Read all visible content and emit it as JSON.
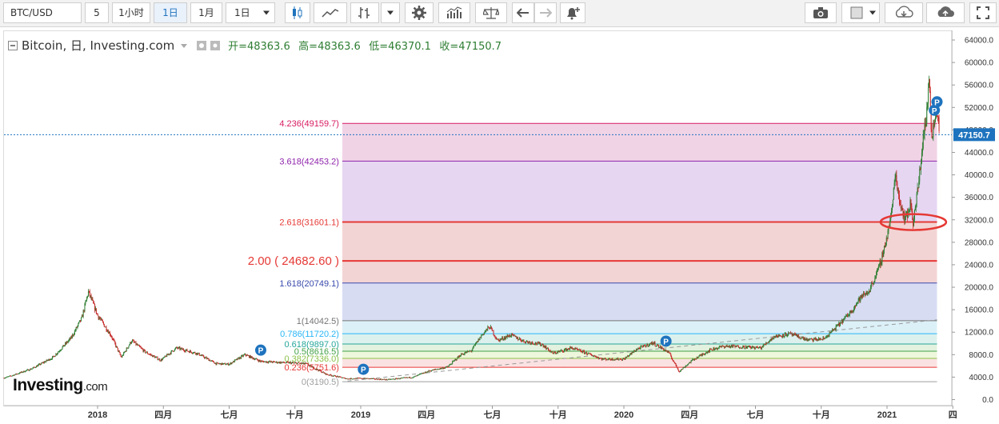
{
  "toolbar": {
    "symbol": "BTC/USD",
    "interval_value": "5",
    "btn_1h": "1小时",
    "btn_1d": "1日",
    "btn_1mo": "1月",
    "btn_1d_b": "1日"
  },
  "header": {
    "title": "Bitcoin, 日, Investing.com",
    "open": "开=48363.6",
    "high": "高=48363.6",
    "low": "低=46370.1",
    "close": "收=47150.7"
  },
  "logo": {
    "brand": "Investing",
    "suffix": ".com"
  },
  "current_price_label": "47150.7",
  "colors": {
    "accent": "#1e73be",
    "price_tag": "#1e73be",
    "candle_up": "#2e7d32",
    "candle_down": "#c62828",
    "annotation_red": "#e53935"
  },
  "chart_data": {
    "type": "candlestick",
    "title": "Bitcoin, 日, Investing.com",
    "ylim": [
      -500,
      65000
    ],
    "y_ticks": [
      0,
      4000,
      8000,
      12000,
      16000,
      20000,
      24000,
      28000,
      32000,
      36000,
      40000,
      44000,
      48000,
      52000,
      56000,
      60000,
      64000
    ],
    "y_tick_labels": [
      "0.0",
      "4000.0",
      "8000.0",
      "12000.0",
      "16000.0",
      "20000.0",
      "24000.0",
      "28000.0",
      "32000.0",
      "36000.0",
      "40000.0",
      "44000.0",
      "48000.0",
      "52000.0",
      "56000.0",
      "60000.0",
      "64000.0"
    ],
    "x_ticks": [
      {
        "label": "2018",
        "t": 2018.0
      },
      {
        "label": "四月",
        "t": 2018.25
      },
      {
        "label": "七月",
        "t": 2018.5
      },
      {
        "label": "十月",
        "t": 2018.75
      },
      {
        "label": "2019",
        "t": 2019.0
      },
      {
        "label": "四月",
        "t": 2019.25
      },
      {
        "label": "七月",
        "t": 2019.5
      },
      {
        "label": "十月",
        "t": 2019.75
      },
      {
        "label": "2020",
        "t": 2020.0
      },
      {
        "label": "四月",
        "t": 2020.25
      },
      {
        "label": "七月",
        "t": 2020.5
      },
      {
        "label": "十月",
        "t": 2020.75
      },
      {
        "label": "2021",
        "t": 2021.0
      },
      {
        "label": "四",
        "t": 2021.25
      }
    ],
    "price_path": [
      [
        2017.58,
        3000
      ],
      [
        2017.67,
        4200
      ],
      [
        2017.75,
        5500
      ],
      [
        2017.83,
        7500
      ],
      [
        2017.9,
        11000
      ],
      [
        2017.94,
        14500
      ],
      [
        2017.965,
        19200
      ],
      [
        2018.0,
        15000
      ],
      [
        2018.05,
        11500
      ],
      [
        2018.09,
        7500
      ],
      [
        2018.13,
        10500
      ],
      [
        2018.18,
        8500
      ],
      [
        2018.24,
        7000
      ],
      [
        2018.3,
        9200
      ],
      [
        2018.38,
        8200
      ],
      [
        2018.45,
        6400
      ],
      [
        2018.5,
        6300
      ],
      [
        2018.56,
        8000
      ],
      [
        2018.62,
        6800
      ],
      [
        2018.7,
        6600
      ],
      [
        2018.79,
        6400
      ],
      [
        2018.87,
        4500
      ],
      [
        2018.95,
        3700
      ],
      [
        2019.0,
        3800
      ],
      [
        2019.1,
        3550
      ],
      [
        2019.2,
        4000
      ],
      [
        2019.26,
        5100
      ],
      [
        2019.33,
        5800
      ],
      [
        2019.38,
        8000
      ],
      [
        2019.42,
        8700
      ],
      [
        2019.46,
        11500
      ],
      [
        2019.49,
        13000
      ],
      [
        2019.52,
        10500
      ],
      [
        2019.57,
        11500
      ],
      [
        2019.62,
        10400
      ],
      [
        2019.69,
        9800
      ],
      [
        2019.73,
        8200
      ],
      [
        2019.8,
        9200
      ],
      [
        2019.85,
        8400
      ],
      [
        2019.92,
        7200
      ],
      [
        2020.0,
        7200
      ],
      [
        2020.05,
        9000
      ],
      [
        2020.11,
        10100
      ],
      [
        2020.17,
        8400
      ],
      [
        2020.21,
        5000
      ],
      [
        2020.26,
        7000
      ],
      [
        2020.33,
        8900
      ],
      [
        2020.38,
        9500
      ],
      [
        2020.45,
        9400
      ],
      [
        2020.52,
        9200
      ],
      [
        2020.57,
        11200
      ],
      [
        2020.63,
        11700
      ],
      [
        2020.7,
        10600
      ],
      [
        2020.76,
        10800
      ],
      [
        2020.81,
        13000
      ],
      [
        2020.86,
        15500
      ],
      [
        2020.9,
        18200
      ],
      [
        2020.93,
        19200
      ],
      [
        2020.97,
        23500
      ],
      [
        2021.0,
        29000
      ],
      [
        2021.02,
        34000
      ],
      [
        2021.03,
        40500
      ],
      [
        2021.05,
        35000
      ],
      [
        2021.07,
        32000
      ],
      [
        2021.09,
        35000
      ],
      [
        2021.1,
        31500
      ],
      [
        2021.12,
        38500
      ],
      [
        2021.14,
        48000
      ],
      [
        2021.15,
        50000
      ],
      [
        2021.16,
        57500
      ],
      [
        2021.17,
        47000
      ],
      [
        2021.19,
        52000
      ],
      [
        2021.2,
        47150.7
      ]
    ],
    "fib_levels": [
      {
        "label": "0(3190.5)",
        "value": 3190.5,
        "color": "#9e9e9e",
        "fill": "#ffffff"
      },
      {
        "label": "0.236(5751.6)",
        "value": 5751.6,
        "color": "#e53935",
        "fill": "#fbe2e2"
      },
      {
        "label": "0.382(7336.0)",
        "value": 7336.0,
        "color": "#8bc34a",
        "fill": "#eef7dc"
      },
      {
        "label": "0.5(8616.5)",
        "value": 8616.5,
        "color": "#43a047",
        "fill": "#e2f2df"
      },
      {
        "label": "0.618(9897.0)",
        "value": 9897.0,
        "color": "#26a69a",
        "fill": "#dcf1ee"
      },
      {
        "label": "0.786(11720.2)",
        "value": 11720.2,
        "color": "#29b6f6",
        "fill": "#dcf0f8"
      },
      {
        "label": "1(14042.5)",
        "value": 14042.5,
        "color": "#757575",
        "fill": "#d8dcf3"
      },
      {
        "label": "1.618(20749.1)",
        "value": 20749.1,
        "color": "#3949ab",
        "fill": "#f3d4d4"
      },
      {
        "label": "2.618(31601.1)",
        "value": 31601.1,
        "color": "#e53935",
        "fill": "#e6d6f2"
      },
      {
        "label": "3.618(42453.2)",
        "value": 42453.2,
        "color": "#8e24aa",
        "fill": "#f1d3e6"
      },
      {
        "label": "4.236(49159.7)",
        "value": 49159.7,
        "color": "#d81b60",
        "fill": null
      }
    ],
    "extra_level": {
      "label": "2.00 ( 24682.60 )",
      "value": 24682.6,
      "color": "#e53935"
    },
    "fib_start_t": 2018.93,
    "fib_end_t": 2021.19,
    "trend_line": {
      "t1": 2018.95,
      "v1": 3300,
      "t2": 2021.19,
      "v2": 14200
    },
    "annotation_ellipse": {
      "t": 2021.1,
      "v": 31600
    },
    "current_price": 47150.7,
    "markers": [
      {
        "label": "P",
        "t": 2018.62,
        "v": 8800
      },
      {
        "label": "P",
        "t": 2019.01,
        "v": 5400
      },
      {
        "label": "P",
        "t": 2020.16,
        "v": 10400
      },
      {
        "label": "P",
        "t": 2021.18,
        "v": 51500
      },
      {
        "label": "P",
        "t": 2021.19,
        "v": 53000
      }
    ]
  }
}
